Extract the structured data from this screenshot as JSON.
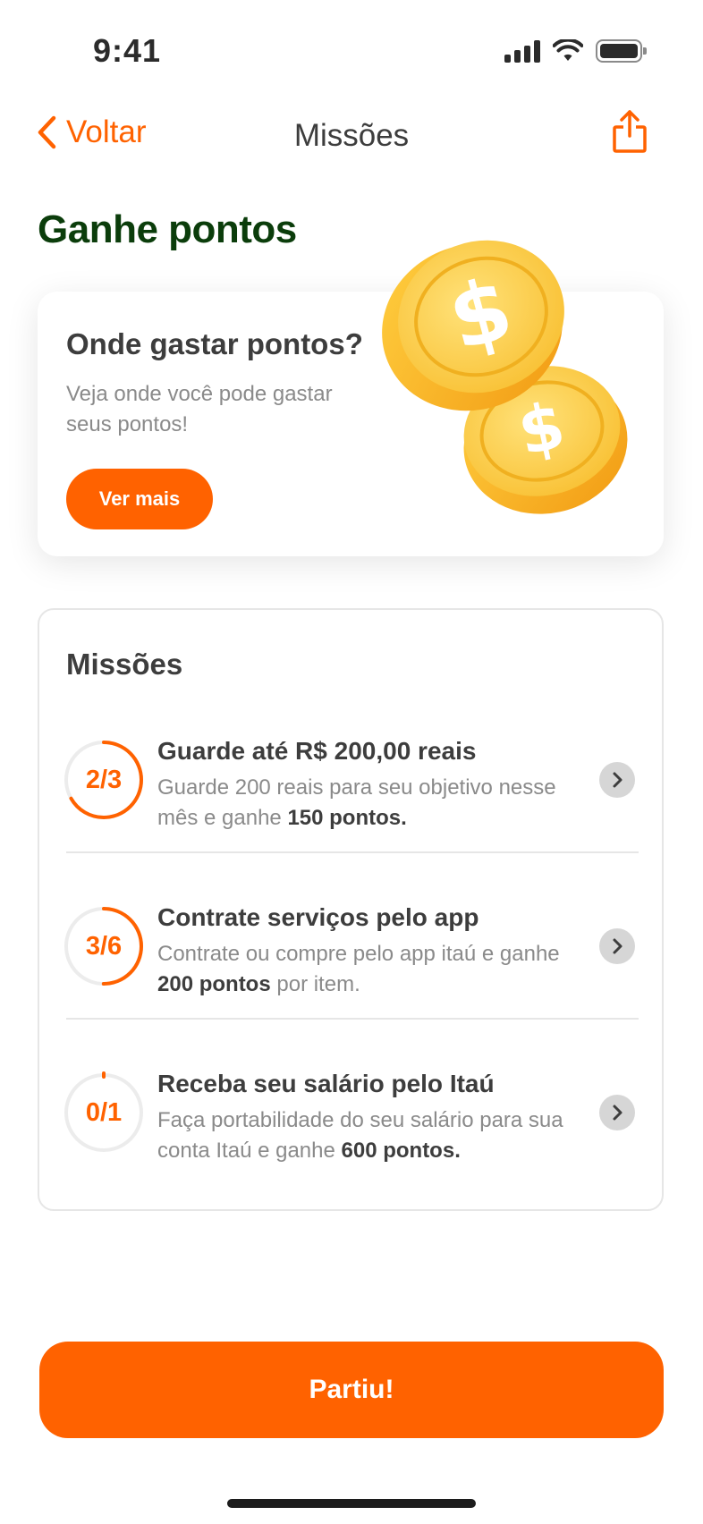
{
  "status_bar": {
    "time": "9:41"
  },
  "nav": {
    "back_label": "Voltar",
    "title": "Missões"
  },
  "page": {
    "heading": "Ganhe pontos"
  },
  "promo": {
    "title": "Onde gastar pontos?",
    "description": "Veja onde você pode gastar seus pontos!",
    "button_label": "Ver mais"
  },
  "missions": {
    "title": "Missões",
    "items": [
      {
        "progress_label": "2/3",
        "progress": 0.6667,
        "title": "Guarde até R$ 200,00 reais",
        "desc_before": "Guarde 200 reais para seu objetivo nesse mês e ganhe ",
        "desc_bold": "150 pontos.",
        "desc_after": ""
      },
      {
        "progress_label": "3/6",
        "progress": 0.5,
        "title": "Contrate serviços pelo app",
        "desc_before": "Contrate ou compre pelo app itaú e ganhe ",
        "desc_bold": "200 pontos",
        "desc_after": " por item."
      },
      {
        "progress_label": "0/1",
        "progress": 0.0,
        "title": "Receba seu salário pelo Itaú",
        "desc_before": "Faça portabilidade do seu salário para sua conta Itaú e ganhe ",
        "desc_bold": "600 pontos.",
        "desc_after": ""
      }
    ]
  },
  "cta": {
    "label": "Partiu!"
  },
  "colors": {
    "accent": "#ff6200",
    "heading_green": "#0b3d0b",
    "text_dark": "#3d3d3d",
    "text_muted": "#8a8a8a"
  },
  "icons": {
    "back": "chevron-left-icon",
    "share": "share-icon",
    "row_chevron": "chevron-right-icon"
  }
}
